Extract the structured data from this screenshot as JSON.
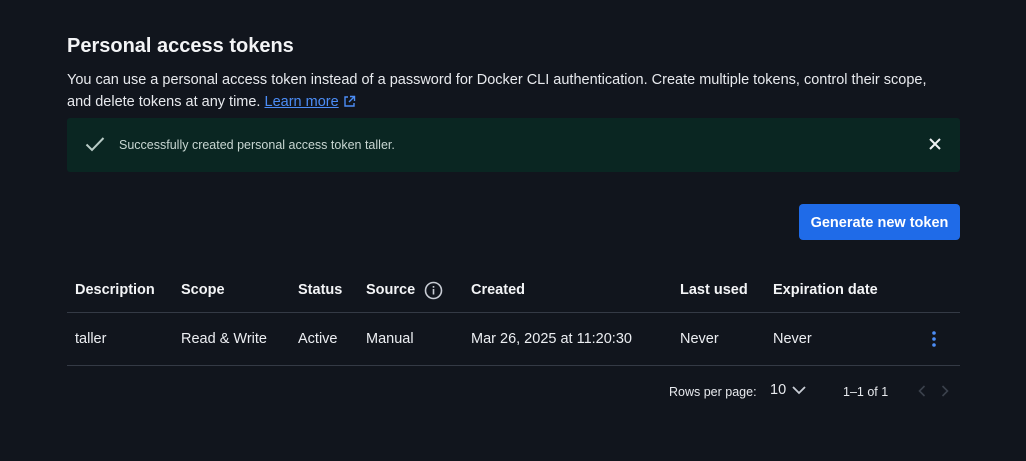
{
  "page": {
    "title": "Personal access tokens",
    "description": "You can use a personal access token instead of a password for Docker CLI authentication. Create multiple tokens, control their scope, and delete tokens at any time.",
    "learn_more": "Learn more"
  },
  "alert": {
    "message": "Successfully created personal access token taller.",
    "icon": "check-icon",
    "close_icon": "close-icon",
    "background": "#0a2622"
  },
  "actions": {
    "generate_label": "Generate new token",
    "accent": "#1f6be8"
  },
  "table": {
    "headers": [
      "Description",
      "Scope",
      "Status",
      "Source",
      "Created",
      "Last used",
      "Expiration date"
    ],
    "rows": [
      {
        "description": "taller",
        "scope": "Read & Write",
        "status": "Active",
        "source": "Manual",
        "created": "Mar 26, 2025 at 11:20:30",
        "last_used": "Never",
        "expiration": "Never"
      }
    ]
  },
  "pagination": {
    "rows_per_page_label": "Rows per page:",
    "rows_per_page_value": "10",
    "range": "1–1 of 1"
  }
}
